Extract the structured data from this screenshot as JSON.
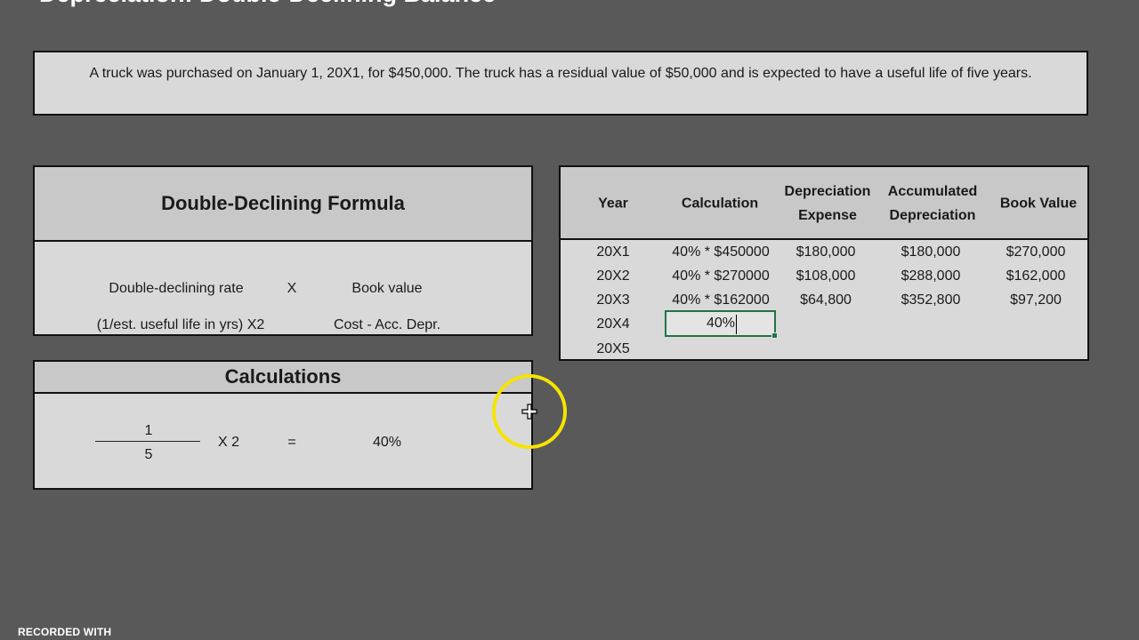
{
  "page": {
    "title": "Depreciation: Double-Declining Balance",
    "problem_text": "A truck was purchased on January 1, 20X1, for $450,000. The truck has a residual value of $50,000 and is expected to have a useful life of five years.",
    "watermark": "RECORDED WITH"
  },
  "formula": {
    "heading": "Double-Declining Formula",
    "left_label": "Double-declining rate",
    "operator": "X",
    "right_label": "Book value",
    "left_detail": "(1/est. useful life in yrs) X2",
    "right_detail": "Cost - Acc. Depr."
  },
  "calculations": {
    "heading": "Calculations",
    "numerator": "1",
    "denominator": "5",
    "multiplier": "X 2",
    "equals": "=",
    "result": "40%"
  },
  "table": {
    "headers": {
      "year": "Year",
      "calculation": "Calculation",
      "dep_expense_1": "Depreciation",
      "dep_expense_2": "Expense",
      "accum_1": "Accumulated",
      "accum_2": "Depreciation",
      "book_value": "Book Value"
    },
    "rows": [
      {
        "year": "20X1",
        "calculation": "40% * $450000",
        "expense": "$180,000",
        "accumulated": "$180,000",
        "book": "$270,000"
      },
      {
        "year": "20X2",
        "calculation": "40% * $270000",
        "expense": "$108,000",
        "accumulated": "$288,000",
        "book": "$162,000"
      },
      {
        "year": "20X3",
        "calculation": "40% * $162000",
        "expense": "$64,800",
        "accumulated": "$352,800",
        "book": "$97,200"
      },
      {
        "year": "20X4",
        "calculation": "40%",
        "expense": "",
        "accumulated": "",
        "book": ""
      },
      {
        "year": "20X5",
        "calculation": "",
        "expense": "",
        "accumulated": "",
        "book": ""
      }
    ]
  },
  "colors": {
    "background": "#595959",
    "panel": "#d9d9d9",
    "header": "#c8c8c8",
    "selection": "#217346",
    "cursor_highlight": "#f5e400"
  },
  "cursor": {
    "icon": "move-cross-cursor-icon"
  }
}
